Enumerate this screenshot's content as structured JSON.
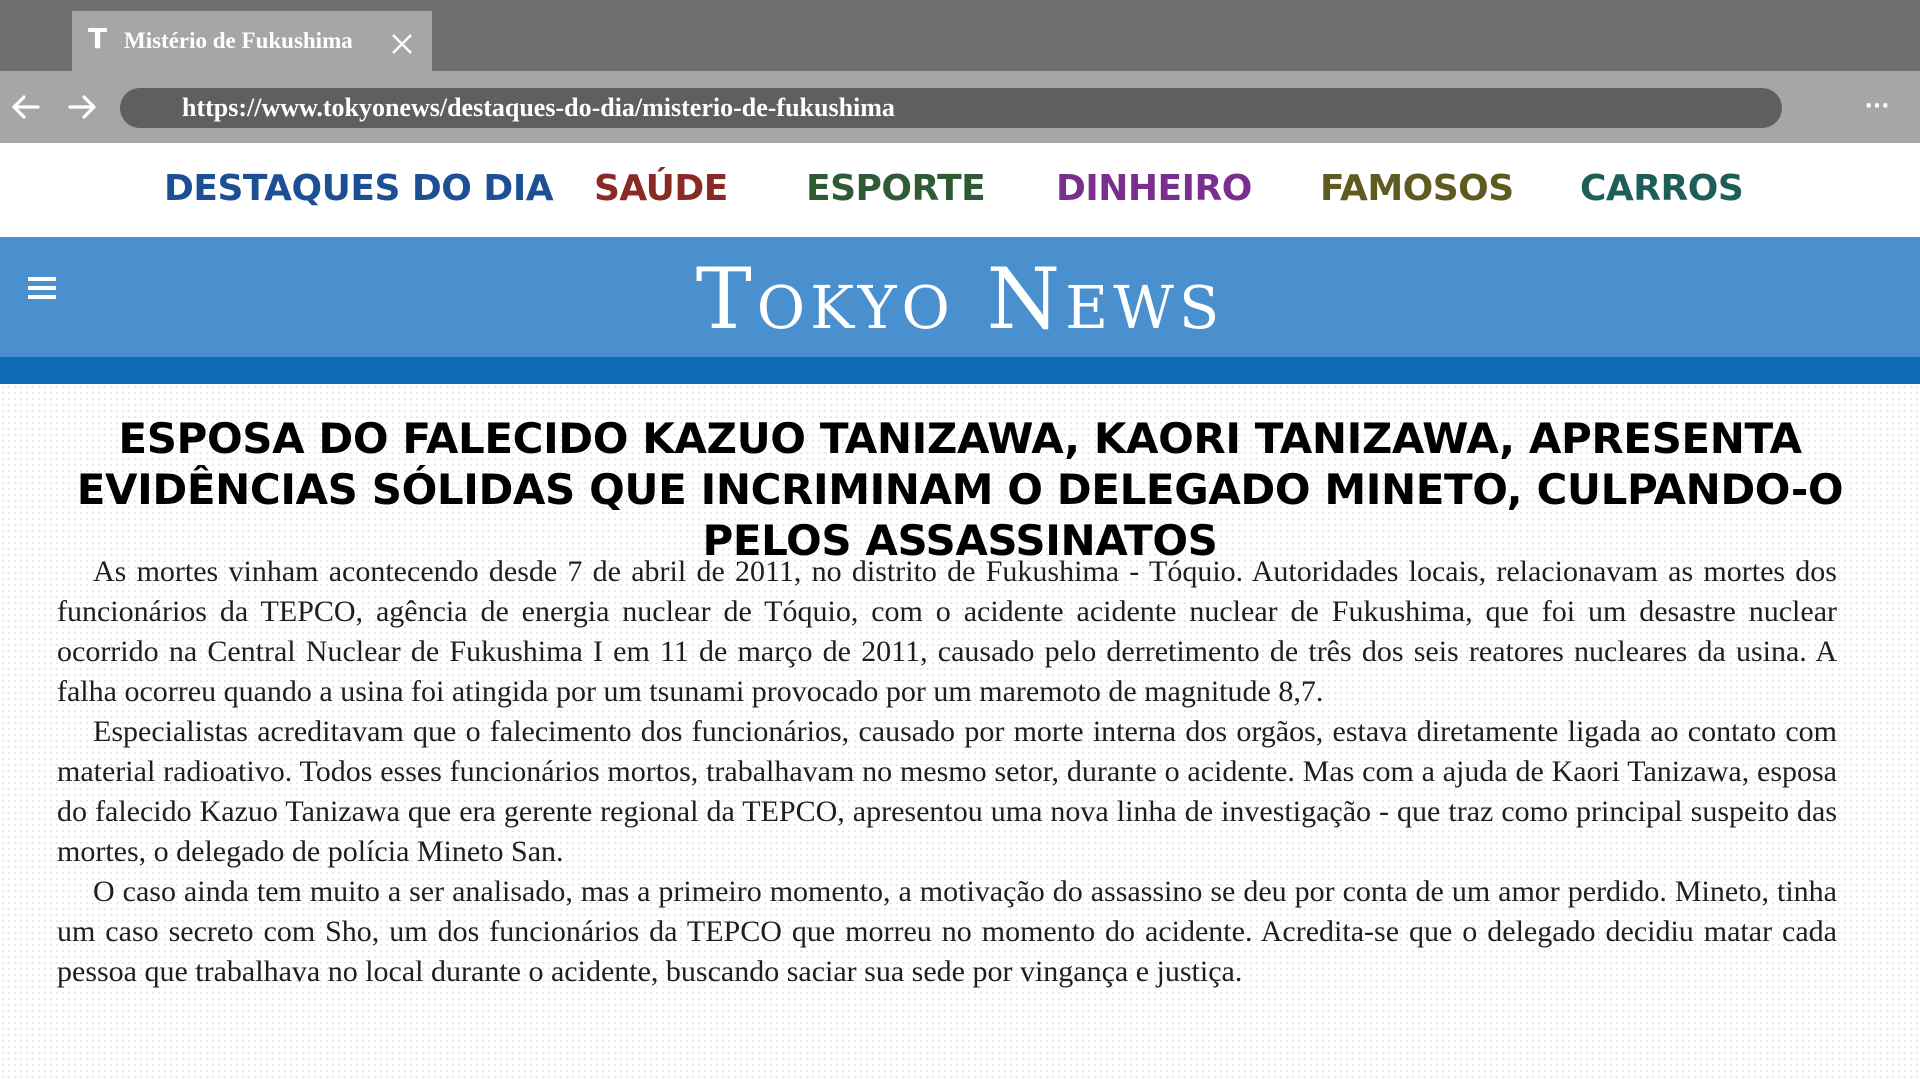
{
  "browser": {
    "tab": {
      "favicon": "T",
      "title": "Mistério de Fukushima",
      "close_icon": "close-icon"
    },
    "nav": {
      "back_icon": "arrow-left-icon",
      "forward_icon": "arrow-right-icon"
    },
    "url": "https://www.tokyonews/destaques-do-dia/misterio-de-fukushima",
    "menu_icon": "more-horizontal-icon"
  },
  "categories": [
    {
      "label": "DESTAQUES DO DIA",
      "color": "#1d4f95"
    },
    {
      "label": "SAÚDE",
      "color": "#8a2a25"
    },
    {
      "label": "ESPORTE",
      "color": "#2f5b34"
    },
    {
      "label": "DINHEIRO",
      "color": "#7a2f8e"
    },
    {
      "label": "FAMOSOS",
      "color": "#5e5a20"
    },
    {
      "label": "CARROS",
      "color": "#1d5f58"
    }
  ],
  "masthead": {
    "logo": "Tokyo news",
    "menu_icon": "hamburger-menu-icon",
    "color": "#4a90cf",
    "stripe_color": "#0d6cb4"
  },
  "article": {
    "headline": "ESPOSA DO FALECIDO KAZUO TANIZAWA, KAORI TANIZAWA, APRESENTA EVIDÊNCIAS SÓLIDAS QUE INCRIMINAM O DELEGADO MINETO, CULPANDO-O PELOS ASSASSINATOS",
    "paragraphs": [
      "As mortes vinham acontecendo desde 7 de abril de 2011, no distrito de Fukushima - Tóquio. Autoridades locais, relacionavam as mortes dos funcionários da TEPCO, agência de energia nuclear de Tóquio, com o acidente acidente nuclear de Fukushima, que foi um desastre nuclear ocorrido na Central Nuclear de Fukushima I em 11 de março de 2011, causado pelo derretimento de três dos seis reatores nucleares da usina. A falha ocorreu quando a usina foi atingida por um tsunami provocado por um maremoto de magnitude 8,7.",
      "Especialistas acreditavam que o falecimento dos funcionários, causado por morte interna dos orgãos, estava diretamente ligada ao contato com material radioativo. Todos esses funcionários mortos, trabalhavam no mesmo setor, durante o acidente. Mas com a ajuda de Kaori Tanizawa, esposa do falecido Kazuo Tanizawa que era gerente regional da TEPCO, apresentou uma nova linha de investigação - que traz como principal suspeito das mortes, o delegado de polícia Mineto San.",
      "O caso ainda tem muito a ser analisado, mas a primeiro momento, a motivação do assassino se deu por conta de um amor perdido. Mineto, tinha um caso secreto com Sho, um dos funcionários da TEPCO que morreu no momento do acidente. Acredita-se que o delegado decidiu matar cada pessoa que trabalhava no local durante o acidente, buscando saciar sua sede por vingança e justiça."
    ]
  }
}
